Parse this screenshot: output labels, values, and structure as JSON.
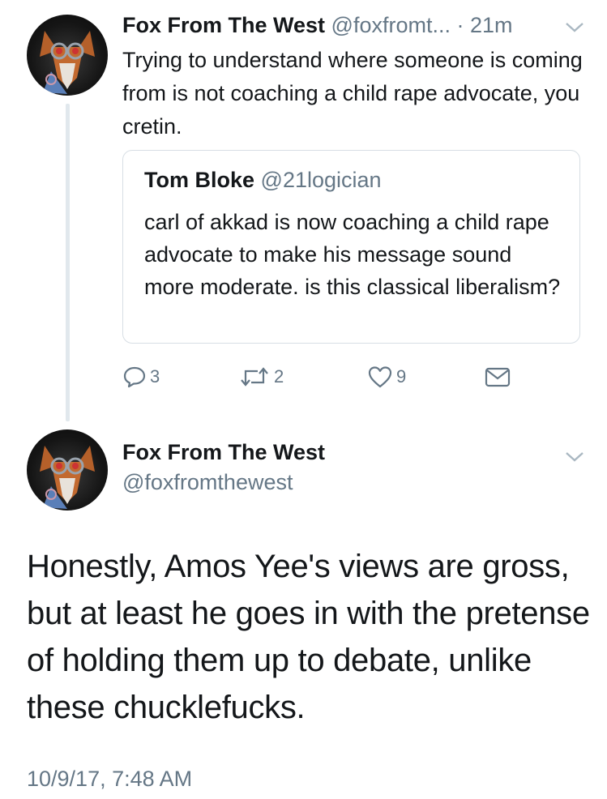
{
  "tweet1": {
    "display_name": "Fox From The West",
    "handle": "@foxfromt...",
    "separator": " · ",
    "time": "21m",
    "text": "Trying to understand where someone is coming from is not coaching a child rape advocate, you cretin.",
    "quoted": {
      "display_name": "Tom Bloke",
      "handle": "@21logician",
      "text": "carl of akkad is now coaching a child rape advocate to make his message sound more moderate. is this classical liberalism?"
    },
    "actions": {
      "reply_count": "3",
      "retweet_count": "2",
      "like_count": "9"
    }
  },
  "tweet2": {
    "display_name": "Fox From The West",
    "handle": "@foxfromthewest",
    "text": "Honestly, Amos Yee's views are gross, but at least he goes in with the pretense of holding them up to debate, unlike these chucklefucks.",
    "timestamp": "10/9/17, 7:48 AM"
  },
  "icons": {
    "reply": "reply-icon",
    "retweet": "retweet-icon",
    "like": "heart-icon",
    "dm": "envelope-icon",
    "menu": "chevron-down-icon"
  },
  "colors": {
    "text": "#14171a",
    "secondary": "#657786",
    "border": "#e1e8ed"
  }
}
